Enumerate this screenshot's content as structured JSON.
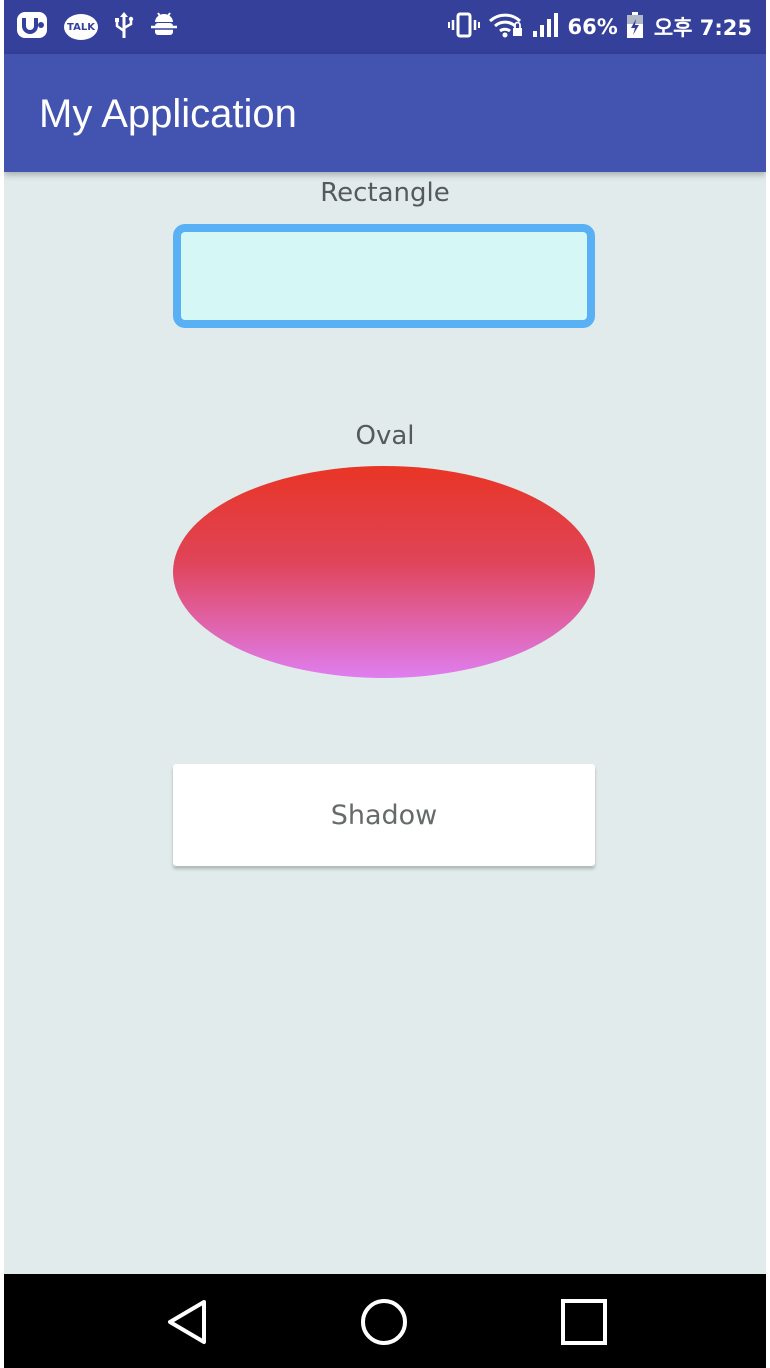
{
  "status_bar": {
    "left_icons": [
      "u-app-icon",
      "talk-bubble-icon",
      "usb-icon",
      "android-debug-icon"
    ],
    "talk_label": "TALK",
    "battery_percent": "66%",
    "time": "오후 7:25",
    "right_icons": [
      "vibrate-icon",
      "wifi-icon",
      "signal-icon",
      "battery-icon"
    ]
  },
  "app_bar": {
    "title": "My Application",
    "color": "#4354b0"
  },
  "content": {
    "rectangle_label": "Rectangle",
    "oval_label": "Oval",
    "shadow_label": "Shadow",
    "rectangle_fill": "#d5f7f5",
    "rectangle_stroke": "#5ab0f5",
    "oval_gradient_top": "#e83525",
    "oval_gradient_bottom": "#df7ef0",
    "background": "#e1ebeb"
  },
  "nav_bar": {
    "buttons": [
      "back-icon",
      "home-icon",
      "recents-icon"
    ]
  }
}
